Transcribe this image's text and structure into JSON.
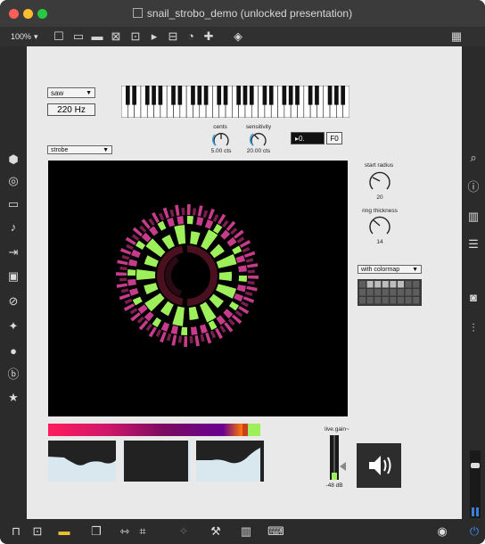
{
  "window": {
    "title": "snail_strobo_demo (unlocked presentation)",
    "zoom": "100%",
    "traffic_lights": [
      "#ff5f57",
      "#febc2e",
      "#28c840"
    ]
  },
  "patch": {
    "waveform_menu": "saw",
    "frequency": "220 Hz",
    "display_menu": "strobe",
    "cents_label": "cents",
    "cents_value": "5.00 cts",
    "sensitivity_label": "sensitivity",
    "sensitivity_value": "20.00 cts",
    "note_number": "0.",
    "note_name": "F0",
    "start_radius_label": "start radius",
    "start_radius_value": "20",
    "ring_thickness_label": "ring thickness",
    "ring_thickness_value": "14",
    "colormap_menu": "with colormap",
    "gain_label": "live.gain~",
    "gain_value": "-48 dB"
  },
  "colors": {
    "accent_green": "#9ef05a",
    "magenta": "#c63c8a",
    "dark_red": "#4a1020",
    "canvas_bg": "#e9e9e9"
  },
  "icons": {
    "left": [
      "cube-icon",
      "target-icon",
      "film-icon",
      "music-note-icon",
      "skip-icon",
      "image-icon",
      "paperclip-icon",
      "plugin-icon",
      "badge-icon",
      "b-icon",
      "star-icon"
    ],
    "right": [
      "search-icon",
      "info-icon",
      "book-icon",
      "list-icon",
      "camera-icon",
      "mixer-icon"
    ]
  }
}
